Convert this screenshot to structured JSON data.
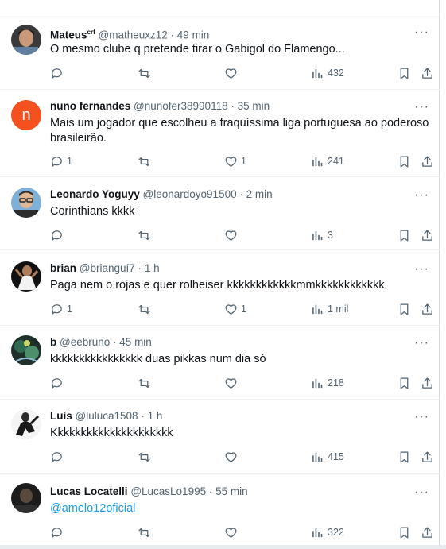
{
  "replies": [
    {
      "name": "Mateus",
      "badge": "crf",
      "handle": "@matheuxz12",
      "time": "49 min",
      "text": "O mesmo clube q pretende tirar o Gabigol do Flamengo...",
      "replies": "",
      "retweets": "",
      "likes": "",
      "views": "432",
      "avatar": "photo-dark-hair"
    },
    {
      "name": "nuno fernandes",
      "handle": "@nunofer38990118",
      "time": "35 min",
      "text": "Mais um jogador que escolheu a fraquíssima liga portuguesa ao poderoso brasileirão.",
      "replies": "1",
      "retweets": "",
      "likes": "1",
      "views": "241",
      "avatar_letter": "n",
      "avatar_color": "#f4511e"
    },
    {
      "name": "Leonardo Yoguyy",
      "handle": "@leonardoyo91500",
      "time": "2 min",
      "text": "Corinthians kkkk",
      "replies": "",
      "retweets": "",
      "likes": "",
      "views": "3",
      "avatar": "photo-glasses-man"
    },
    {
      "name": "brian",
      "handle": "@brianguí7",
      "time": "1 h",
      "text": "Paga nem o rojas e quer rolheiser kkkkkkkkkkkkmmkkkkkkkkkkkk",
      "replies": "1",
      "retweets": "",
      "likes": "1",
      "views": "1 mil",
      "avatar": "photo-player-celebrating"
    },
    {
      "name": "b",
      "handle": "@eebruno",
      "time": "45 min",
      "text": "kkkkkkkkkkkkkkkk duas pikkas num dia só",
      "replies": "",
      "retweets": "",
      "likes": "",
      "views": "218",
      "avatar": "photo-illustration-green"
    },
    {
      "name": "Luís",
      "handle": "@luluca1508",
      "time": "1 h",
      "text": "Kkkkkkkkkkkkkkkkkkkkk",
      "replies": "",
      "retweets": "",
      "likes": "",
      "views": "415",
      "avatar": "photo-player-black-white"
    },
    {
      "name": "Lucas Locatelli",
      "handle": "@LucasLo1995",
      "time": "55 min",
      "text": "@amelo12oficial",
      "replies": "",
      "retweets": "",
      "likes": "",
      "views": "322",
      "avatar": "photo-man-dark"
    }
  ],
  "icons": {
    "more": "more-icon",
    "reply": "reply-icon",
    "retweet": "retweet-icon",
    "like": "heart-icon",
    "views": "views-icon",
    "bookmark": "bookmark-icon",
    "share": "share-icon"
  },
  "colors": {
    "link": "#1d9bf0",
    "secondary_text": "#536471",
    "separator": "#eff3f4"
  }
}
